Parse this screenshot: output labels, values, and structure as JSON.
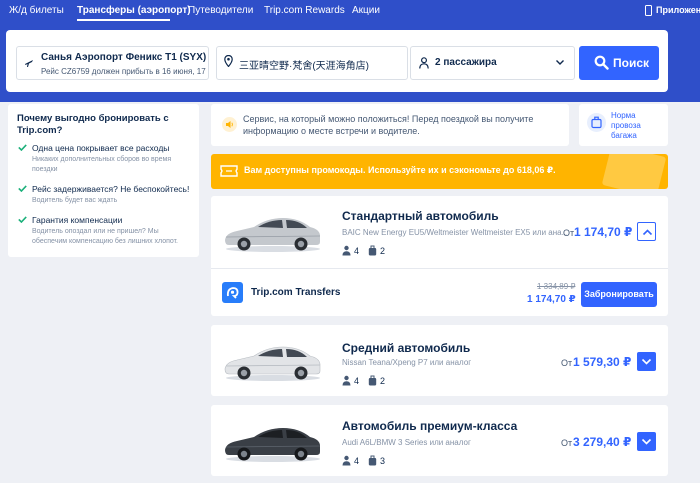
{
  "nav": {
    "items": [
      "Ж/д билеты",
      "Трансферы (аэропорт)",
      "Путеводители",
      "Trip.com Rewards",
      "Акции"
    ],
    "app_label": "Приложение"
  },
  "search": {
    "from_title": "Санья Аэропорт Феникс T1 (SYX)",
    "from_sub": "Рейс CZ6759 должен прибыть в 16 июня, 17...",
    "to": "三亚晴空野·梵舍(天涯海角店)",
    "passengers": "2 пассажира",
    "button": "Поиск"
  },
  "sidebar": {
    "title": "Почему выгодно бронировать с Trip.com?",
    "benefits": [
      {
        "title": "Одна цена покрывает все расходы",
        "desc": "Никаких дополнительных сборов во время поездки"
      },
      {
        "title": "Рейс задерживается? Не беспокойтесь!",
        "desc": "Водитель будет вас ждать"
      },
      {
        "title": "Гарантия компенсации",
        "desc": "Водитель опоздал или не пришел? Мы обеспечим компенсацию без лишних хлопот."
      }
    ]
  },
  "info": {
    "text": "Сервис, на который можно положиться! Перед поездкой вы получите информацию о месте встречи и водителе.",
    "baggage": "Норма провоза багажа"
  },
  "promo": {
    "text": "Вам доступны промокоды. Используйте их и сэкономьте до 618,06 ₽."
  },
  "cars": [
    {
      "title": "Стандартный автомобиль",
      "models": "BAIC New Energy EU5/Weltmeister Weltmeister EX5 или ана...",
      "seats": "4",
      "bags": "2",
      "from": "От",
      "price": "1 174,70 ₽",
      "expanded": true
    },
    {
      "title": "Средний автомобиль",
      "models": "Nissan Teana/Xpeng P7 или аналог",
      "seats": "4",
      "bags": "2",
      "from": "От",
      "price": "1 579,30 ₽",
      "expanded": false
    },
    {
      "title": "Автомобиль премиум-класса",
      "models": "Audi A6L/BMW 3 Series или аналог",
      "seats": "4",
      "bags": "3",
      "from": "От",
      "price": "3 279,40 ₽",
      "expanded": false
    }
  ],
  "vendor": {
    "name": "Trip.com Transfers",
    "old_price": "1 334,89 ₽",
    "price": "1 174,70 ₽",
    "book": "Забронировать"
  },
  "colors": {
    "header": "#2f4fc9",
    "primary": "#3264ff",
    "promo": "#ffb400",
    "text": "#0f294d",
    "check": "#1bb07a"
  },
  "icons": [
    "plane-icon",
    "pin-icon",
    "user-icon",
    "chevron-down-icon",
    "search-icon",
    "check-icon",
    "speaker-icon",
    "baggage-icon",
    "ticket-icon",
    "seat-icon",
    "suitcase-icon",
    "chevron-up-icon",
    "trip-logo-icon",
    "phone-icon"
  ]
}
